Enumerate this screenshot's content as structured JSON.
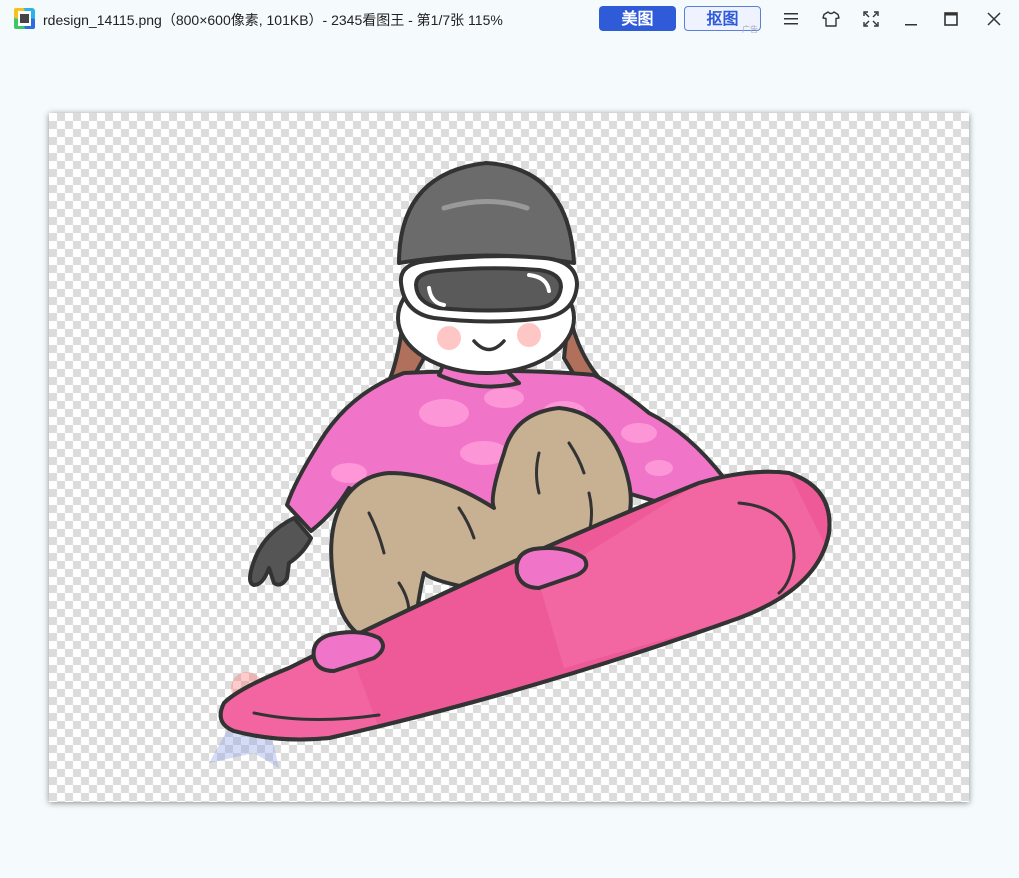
{
  "window": {
    "title": "rdesign_14115.png（800×600像素, 101KB）- 2345看图王 - 第1/7张 115%",
    "app_icon": "app-logo-icon"
  },
  "toolbar": {
    "meitu_label": "美图",
    "koutu_label": "抠图",
    "ad_label": "广告"
  },
  "window_controls": {
    "menu_icon": "menu-icon",
    "skin_icon": "shirt-icon",
    "fullscreen_icon": "fullscreen-icon",
    "minimize_icon": "minimize-icon",
    "maximize_icon": "maximize-icon",
    "close_icon": "close-icon"
  },
  "image": {
    "subject": "snowboarder-illustration",
    "colors": {
      "jacket": "#f075c8",
      "pants": "#c8b193",
      "board": "#ee5a98",
      "hat": "#6b6b6b",
      "outline": "#333333"
    }
  }
}
